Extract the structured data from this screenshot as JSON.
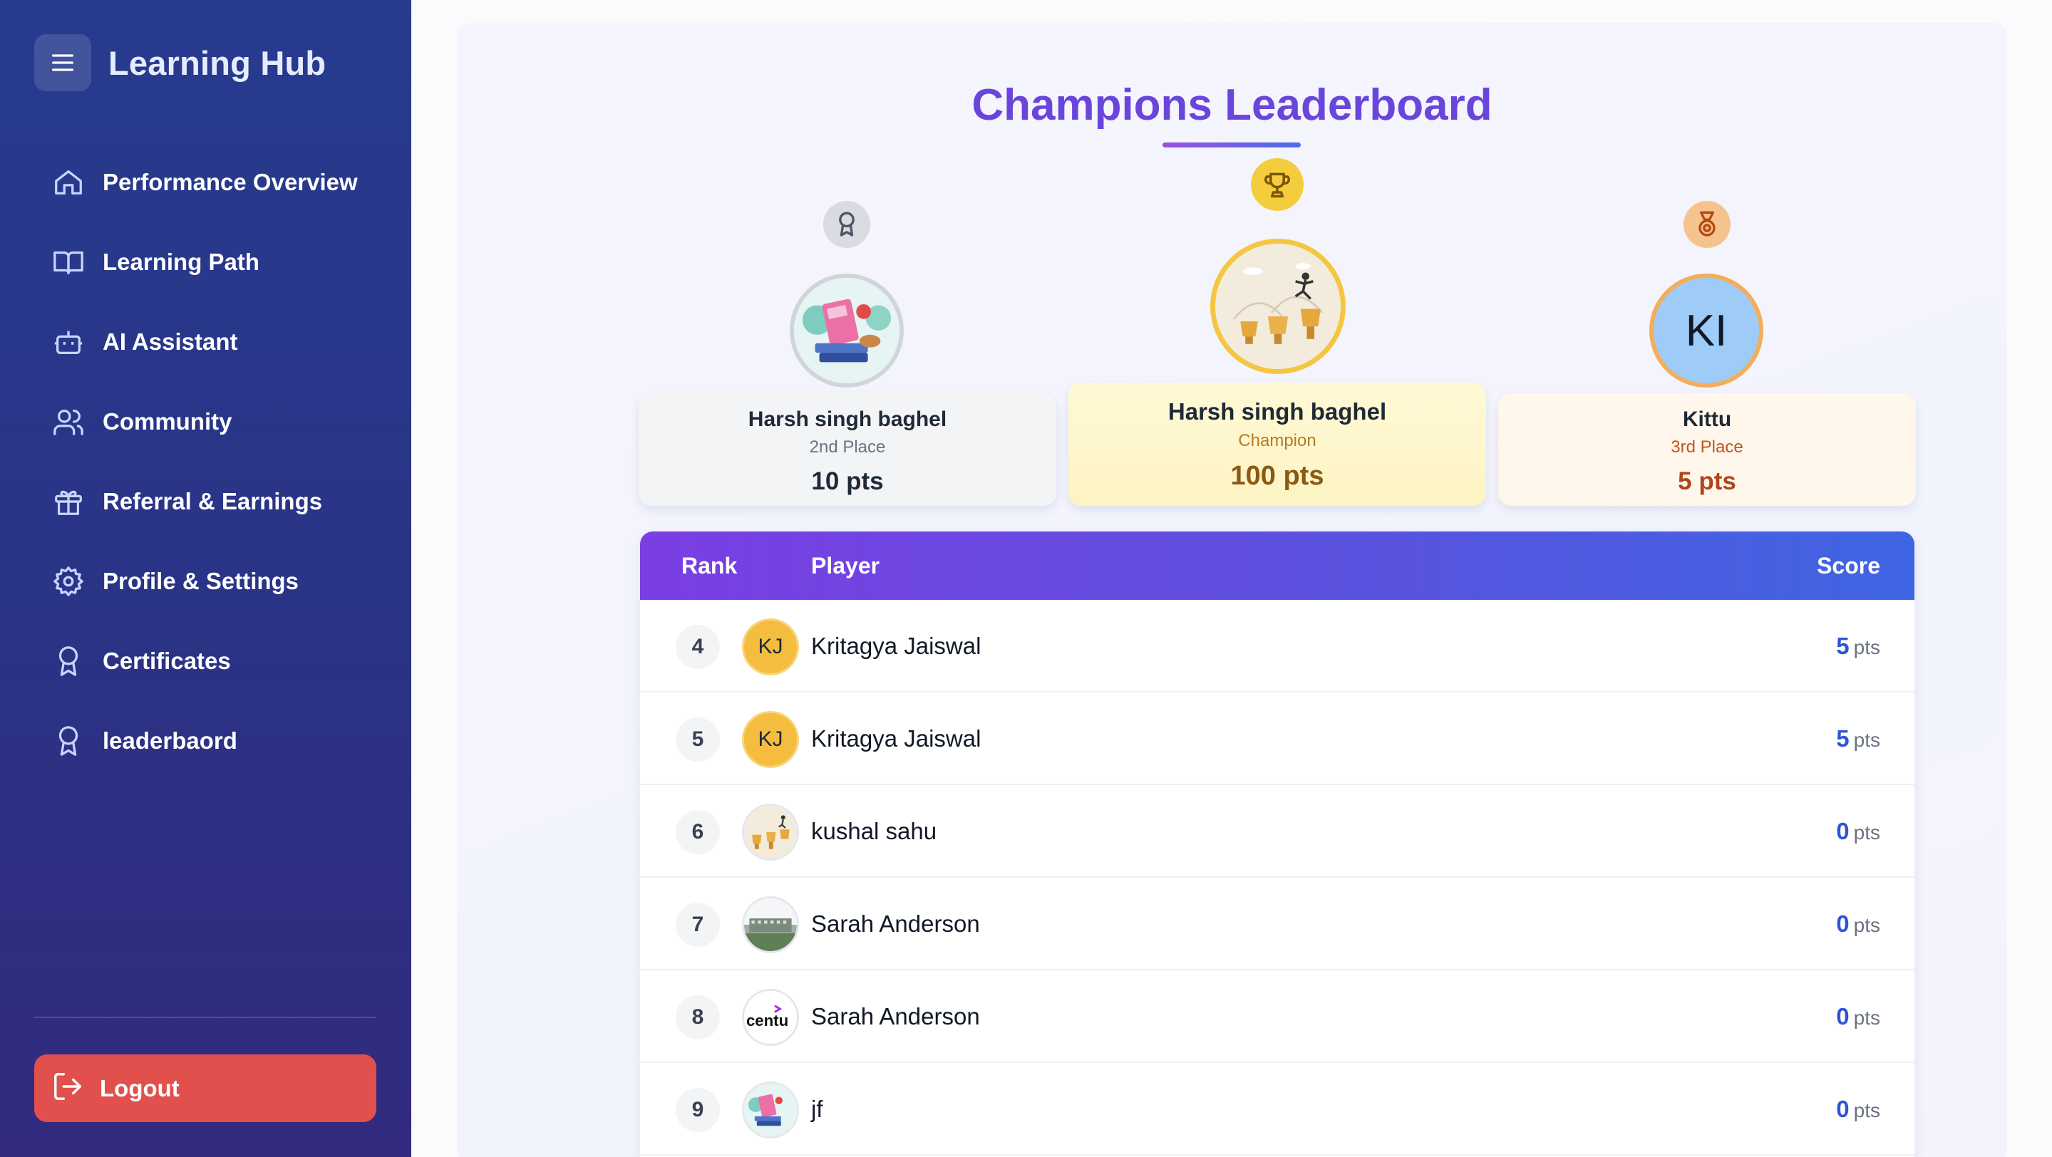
{
  "sidebar": {
    "brand": "Learning Hub",
    "items": [
      {
        "label": "Performance Overview",
        "icon": "home-icon"
      },
      {
        "label": "Learning Path",
        "icon": "book-icon"
      },
      {
        "label": "AI Assistant",
        "icon": "bot-icon"
      },
      {
        "label": "Community",
        "icon": "users-icon"
      },
      {
        "label": "Referral & Earnings",
        "icon": "gift-icon"
      },
      {
        "label": "Profile & Settings",
        "icon": "gear-icon"
      },
      {
        "label": "Certificates",
        "icon": "award-icon"
      },
      {
        "label": "leaderbaord",
        "icon": "award-icon"
      }
    ],
    "logout": "Logout"
  },
  "main": {
    "title": "Champions Leaderboard",
    "podium": {
      "second": {
        "name": "Harsh singh baghel",
        "place": "2nd Place",
        "points": "10 pts"
      },
      "first": {
        "name": "Harsh singh baghel",
        "place": "Champion",
        "points": "100 pts"
      },
      "third": {
        "name": "Kittu",
        "place": "3rd Place",
        "points": "5 pts",
        "initials": "KI"
      }
    },
    "table": {
      "headers": {
        "rank": "Rank",
        "player": "Player",
        "score": "Score"
      },
      "unit": "pts",
      "rows": [
        {
          "rank": "4",
          "name": "Kritagya Jaiswal",
          "score": "5",
          "initials": "KJ"
        },
        {
          "rank": "5",
          "name": "Kritagya Jaiswal",
          "score": "5",
          "initials": "KJ"
        },
        {
          "rank": "6",
          "name": "kushal sahu",
          "score": "0"
        },
        {
          "rank": "7",
          "name": "Sarah Anderson",
          "score": "0"
        },
        {
          "rank": "8",
          "name": "Sarah Anderson",
          "score": "0",
          "logo_text": "centu"
        },
        {
          "rank": "9",
          "name": "jf",
          "score": "0"
        }
      ]
    }
  },
  "colors": {
    "sidebar_top": "#273b8f",
    "sidebar_bottom": "#312a7e",
    "logout": "#e1504c",
    "title": "#6a45dc",
    "table_header_start": "#7b3ee3",
    "table_header_end": "#3f65e3",
    "score_number": "#2f55d4"
  }
}
